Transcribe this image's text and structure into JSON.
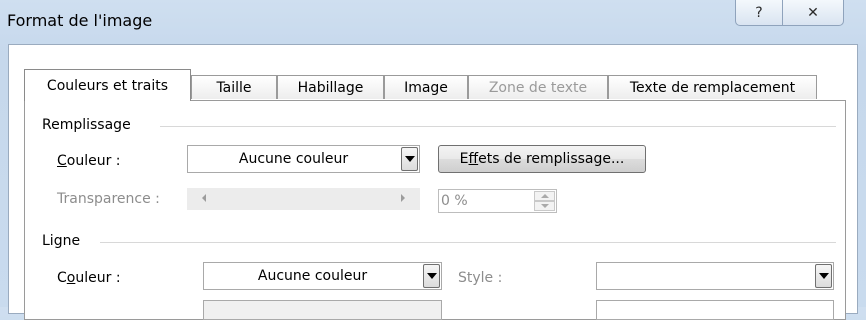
{
  "window": {
    "title": "Format de l'image",
    "help_glyph": "?",
    "close_glyph": "✕"
  },
  "tabs": [
    {
      "label": "Couleurs et traits",
      "active": true,
      "enabled": true
    },
    {
      "label": "Taille",
      "active": false,
      "enabled": true
    },
    {
      "label": "Habillage",
      "active": false,
      "enabled": true
    },
    {
      "label": "Image",
      "active": false,
      "enabled": true
    },
    {
      "label": "Zone de texte",
      "active": false,
      "enabled": false
    },
    {
      "label": "Texte de remplacement",
      "active": false,
      "enabled": true
    }
  ],
  "fill": {
    "section_label": "Remplissage",
    "color_label_prefix": "C",
    "color_label_rest": "ouleur :",
    "color_value": "Aucune couleur",
    "effects_button_prefix": "E",
    "effects_button_accel": "f",
    "effects_button_rest": "fets de remplissage...",
    "transparency_label": "Transparence :",
    "transparency_value": "0 %"
  },
  "line": {
    "section_label": "Ligne",
    "color_label_prefix": "C",
    "color_label_accel": "o",
    "color_label_rest": "uleur :",
    "color_value": "Aucune couleur",
    "style_label": "Style :",
    "style_value": ""
  },
  "colors": {
    "disabled_text": "#8d8d8d",
    "frame_border": "#9aabbf"
  }
}
